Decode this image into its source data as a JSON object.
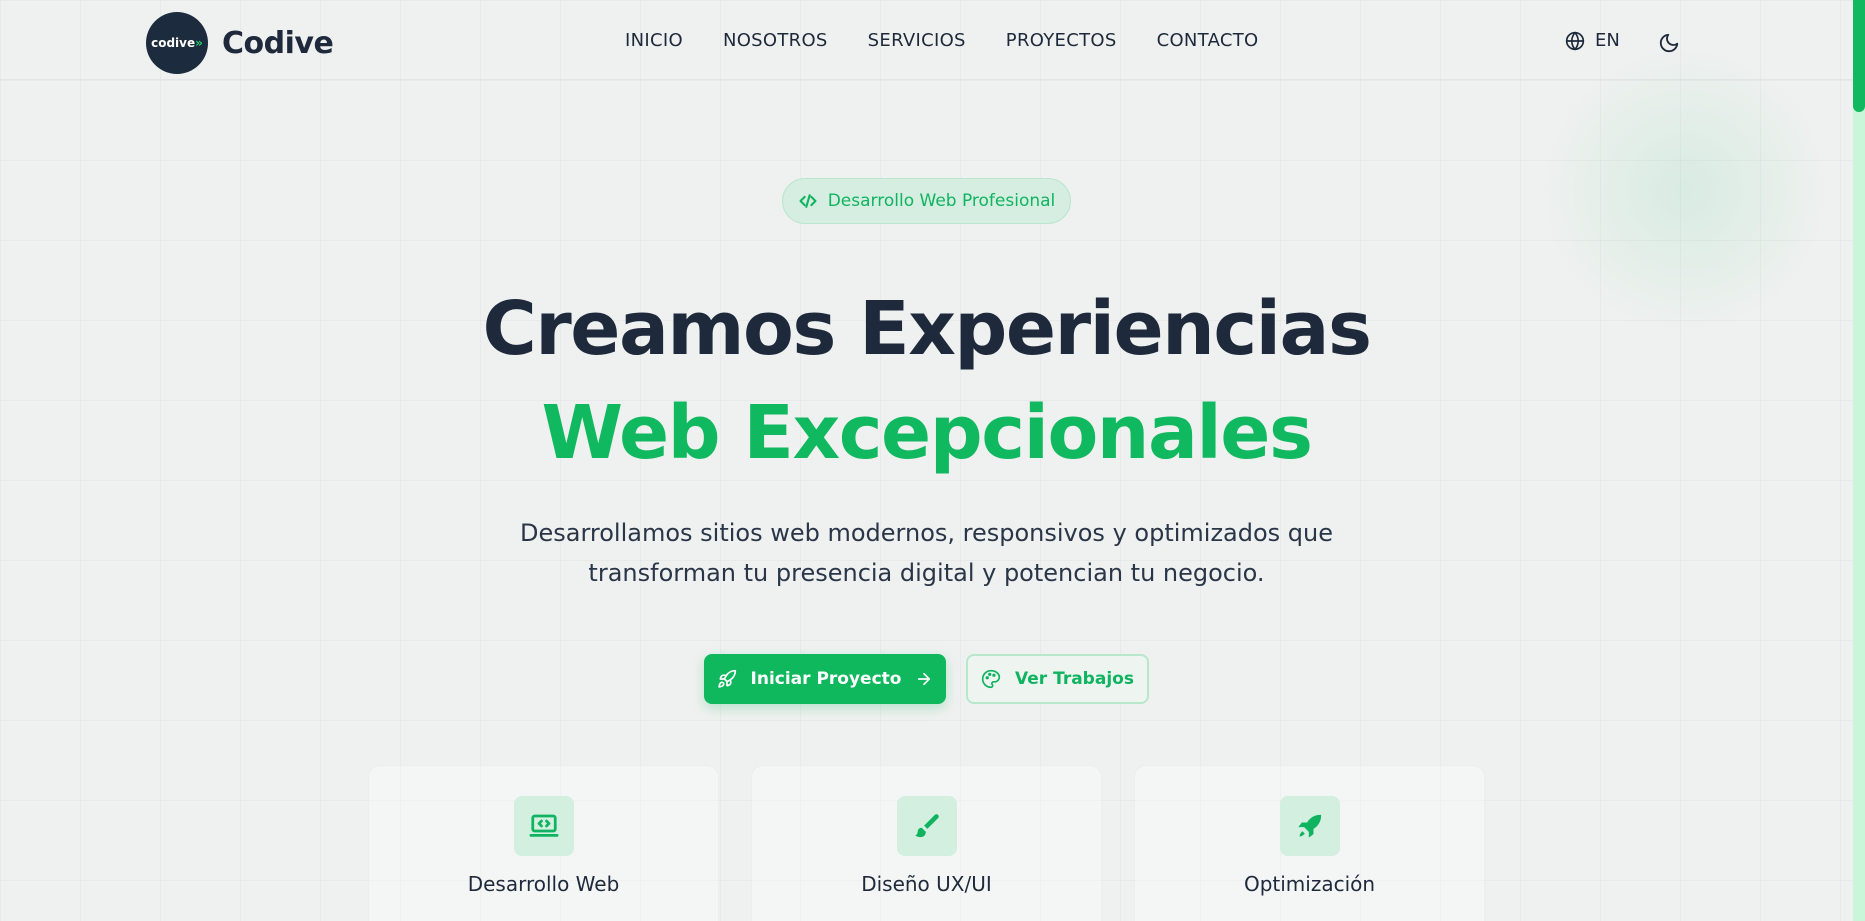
{
  "colors": {
    "accent": "#10b95f",
    "dark": "#1e293b",
    "background": "#eff1f0",
    "accent_light": "#d5eee1"
  },
  "header": {
    "logo_mark": "codive",
    "brand": "Codive",
    "nav": [
      "INICIO",
      "NOSOTROS",
      "SERVICIOS",
      "PROYECTOS",
      "CONTACTO"
    ],
    "language": "EN",
    "language_icon": "globe-icon",
    "theme_icon": "moon-icon"
  },
  "hero": {
    "badge": "Desarrollo Web Profesional",
    "badge_icon": "code-icon",
    "title_line1": "Creamos Experiencias",
    "title_line2": "Web Excepcionales",
    "subtitle_line1": "Desarrollamos sitios web modernos, responsivos y optimizados que",
    "subtitle_line2": "transforman tu presencia digital y potencian tu negocio.",
    "primary_button": "Iniciar Proyecto",
    "primary_icon": "rocket-icon",
    "secondary_button": "Ver Trabajos",
    "secondary_icon": "palette-icon"
  },
  "cards": [
    {
      "title": "Desarrollo Web",
      "icon": "laptop-code-icon"
    },
    {
      "title": "Diseño UX/UI",
      "icon": "paintbrush-icon"
    },
    {
      "title": "Optimización",
      "icon": "rocket-icon"
    }
  ]
}
